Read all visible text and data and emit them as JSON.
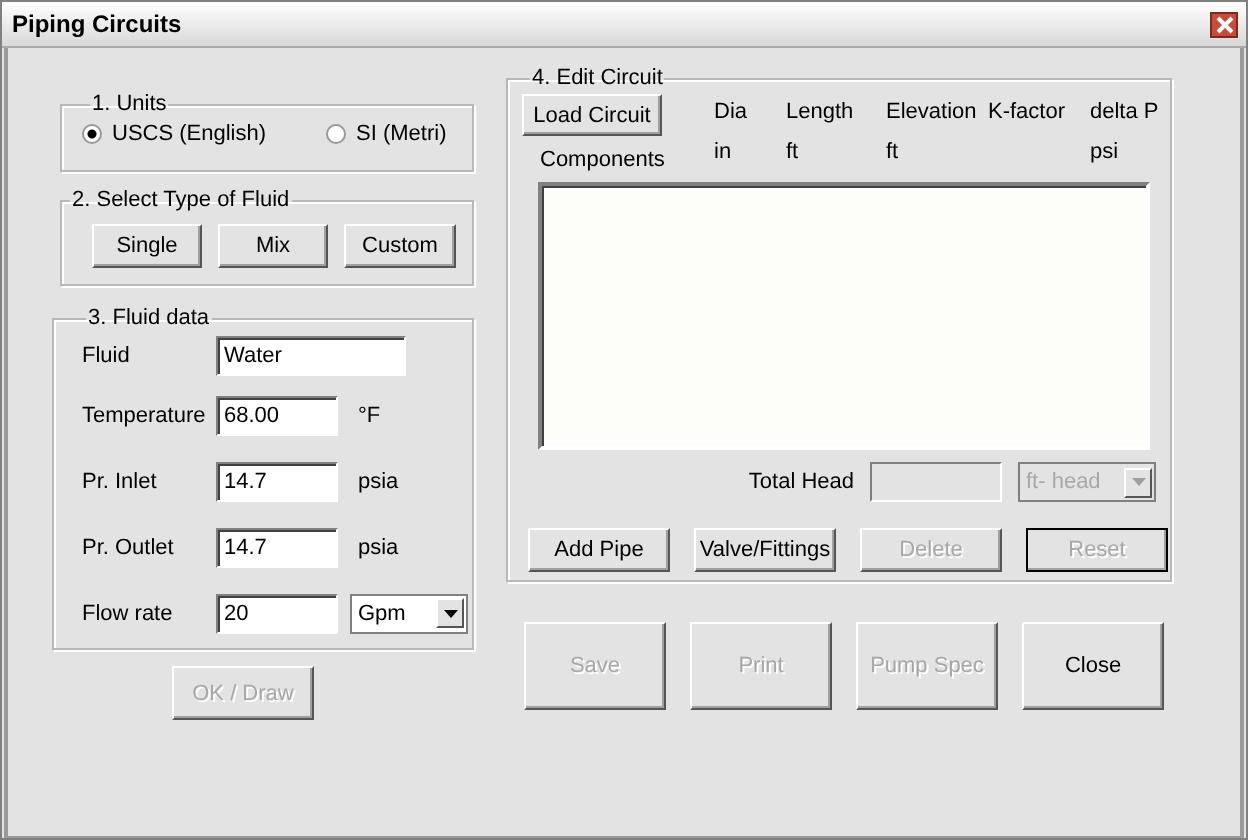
{
  "window": {
    "title": "Piping Circuits"
  },
  "units": {
    "legend": "1. Units",
    "options": [
      {
        "label": "USCS (English)",
        "selected": true
      },
      {
        "label": "SI (Metri)",
        "selected": false
      }
    ]
  },
  "fluid_type": {
    "legend": "2. Select Type of Fluid",
    "buttons": [
      "Single",
      "Mix",
      "Custom"
    ]
  },
  "fluid_data": {
    "legend": "3. Fluid data",
    "rows": [
      {
        "kind": "text",
        "label": "Fluid",
        "value": "Water"
      },
      {
        "kind": "text",
        "label": "Temperature",
        "value": "68.00",
        "unit": "°F"
      },
      {
        "kind": "text",
        "label": "Pr. Inlet",
        "value": "14.7",
        "unit": "psia"
      },
      {
        "kind": "text",
        "label": "Pr. Outlet",
        "value": "14.7",
        "unit": "psia"
      },
      {
        "kind": "select",
        "label": "Flow rate",
        "value": "20",
        "unit": "Gpm"
      }
    ]
  },
  "ok_button": {
    "label": "OK / Draw",
    "disabled": true
  },
  "edit_circuit": {
    "legend": "4. Edit Circuit",
    "load_button": "Load Circuit",
    "components_label": "Components",
    "columns": [
      {
        "name": "Dia",
        "unit": "in"
      },
      {
        "name": "Length",
        "unit": "ft"
      },
      {
        "name": "Elevation",
        "unit": "ft"
      },
      {
        "name": "K-factor"
      },
      {
        "name": "delta P",
        "unit": "psi"
      }
    ],
    "total_head": {
      "label": "Total Head",
      "unit": "ft- head",
      "disabled": true
    },
    "buttons": [
      {
        "label": "Add Pipe",
        "disabled": false,
        "default": false
      },
      {
        "label": "Valve/Fittings",
        "disabled": false,
        "default": false
      },
      {
        "label": "Delete",
        "disabled": true,
        "default": false
      },
      {
        "label": "Reset",
        "disabled": true,
        "default": true
      }
    ]
  },
  "bottom_buttons": [
    {
      "label": "Save",
      "disabled": true
    },
    {
      "label": "Print",
      "disabled": true
    },
    {
      "label": "Pump Spec",
      "disabled": true
    },
    {
      "label": "Close",
      "disabled": false
    }
  ]
}
